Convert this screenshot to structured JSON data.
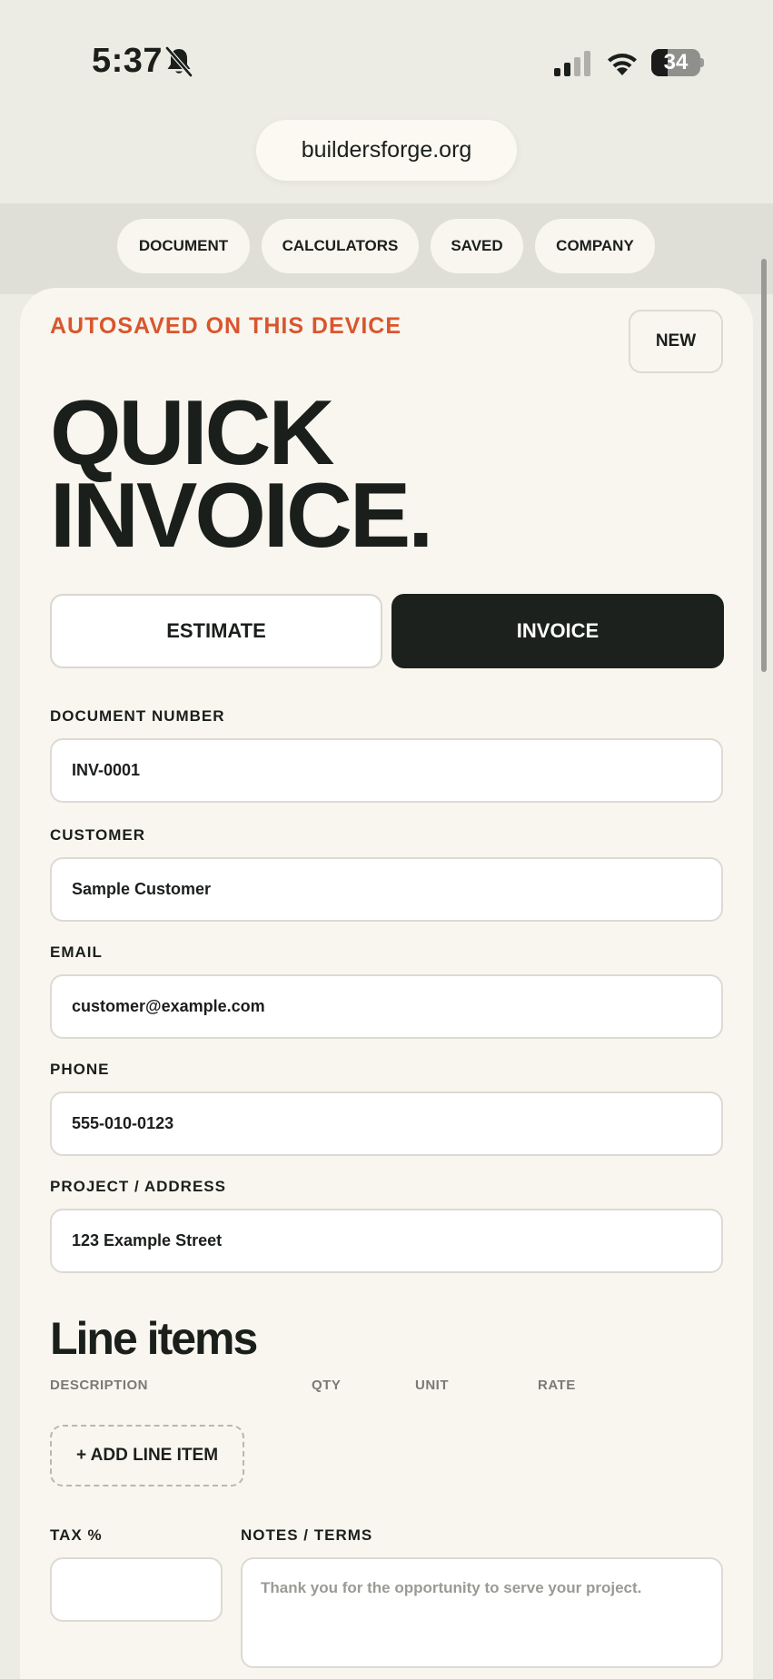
{
  "status_bar": {
    "time": "5:37",
    "battery_percent": "34",
    "battery_level": 0.34,
    "icons": [
      "bell-slash-icon",
      "cellular-signal-icon",
      "wifi-icon",
      "battery-icon"
    ]
  },
  "browser": {
    "url": "buildersforge.org"
  },
  "nav": {
    "tabs": [
      {
        "label": "DOCUMENT"
      },
      {
        "label": "CALCULATORS"
      },
      {
        "label": "SAVED"
      },
      {
        "label": "COMPANY"
      }
    ]
  },
  "header": {
    "autosave_text": "AUTOSAVED ON THIS DEVICE",
    "new_label": "NEW",
    "title_line1": "QUICK",
    "title_line2": "INVOICE."
  },
  "doc_type": {
    "estimate_label": "ESTIMATE",
    "invoice_label": "INVOICE",
    "selected": "INVOICE"
  },
  "fields": {
    "document_number": {
      "label": "DOCUMENT NUMBER",
      "value": "INV-0001"
    },
    "customer": {
      "label": "CUSTOMER",
      "value": "Sample Customer"
    },
    "email": {
      "label": "EMAIL",
      "value": "customer@example.com"
    },
    "phone": {
      "label": "PHONE",
      "value": "555-010-0123"
    },
    "project_address": {
      "label": "PROJECT / ADDRESS",
      "value": "123 Example Street"
    }
  },
  "line_items": {
    "title": "Line items",
    "columns": [
      "DESCRIPTION",
      "QTY",
      "UNIT",
      "RATE"
    ],
    "add_label": "+ ADD LINE ITEM"
  },
  "tax": {
    "label": "TAX %",
    "value": ""
  },
  "notes": {
    "label": "NOTES / TERMS",
    "placeholder": "Thank you for the opportunity to serve your project."
  },
  "colors": {
    "accent": "#d9562d",
    "dark": "#1c211d",
    "card": "#f8f6ef",
    "background": "#ecebe4"
  }
}
